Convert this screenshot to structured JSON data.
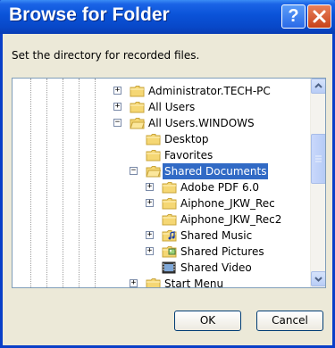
{
  "window": {
    "title": "Browse for Folder",
    "help_glyph": "?"
  },
  "instructions": "Set the directory for recorded files.",
  "tree": {
    "items": [
      {
        "label": "Administrator.TECH-PC",
        "icon": "folder-icon",
        "expander": "+"
      },
      {
        "label": "All Users",
        "icon": "folder-icon",
        "expander": "+"
      },
      {
        "label": "All Users.WINDOWS",
        "icon": "open-folder-icon",
        "expander": "−"
      },
      {
        "label": "Desktop",
        "icon": "folder-icon",
        "expander": ""
      },
      {
        "label": "Favorites",
        "icon": "folder-icon",
        "expander": ""
      },
      {
        "label": "Shared Documents",
        "icon": "open-folder-icon",
        "expander": "−",
        "selected": true
      },
      {
        "label": "Adobe PDF 6.0",
        "icon": "folder-icon",
        "expander": "+"
      },
      {
        "label": "Aiphone_JKW_Rec",
        "icon": "folder-icon",
        "expander": "+"
      },
      {
        "label": "Aiphone_JKW_Rec2",
        "icon": "folder-icon",
        "expander": ""
      },
      {
        "label": "Shared Music",
        "icon": "music-folder-icon",
        "expander": "+"
      },
      {
        "label": "Shared Pictures",
        "icon": "pictures-folder-icon",
        "expander": "+"
      },
      {
        "label": "Shared Video",
        "icon": "video-folder-icon",
        "expander": ""
      },
      {
        "label": "Start Menu",
        "icon": "folder-icon",
        "expander": "+"
      }
    ]
  },
  "buttons": {
    "ok": "OK",
    "cancel": "Cancel"
  },
  "colors": {
    "titlebar": "#0a52d8",
    "selection": "#316ac5",
    "folder": "#f5d774"
  }
}
